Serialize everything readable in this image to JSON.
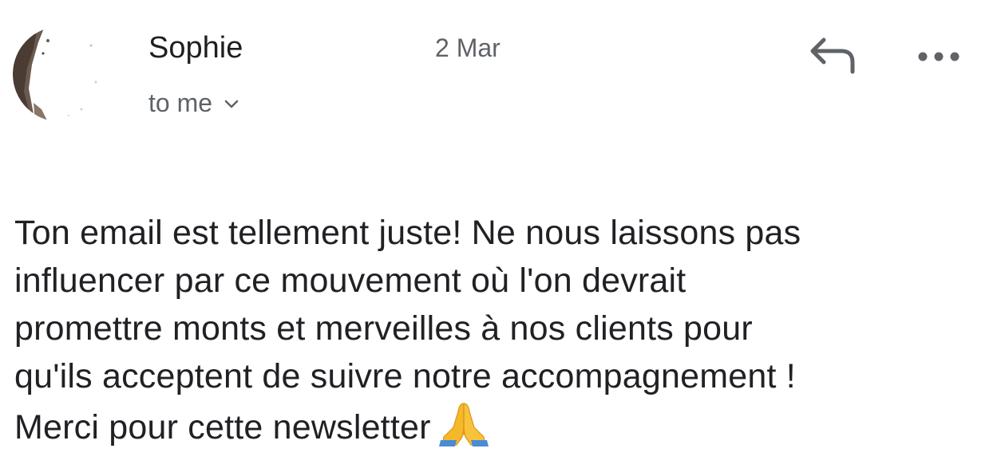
{
  "header": {
    "sender_name": "Sophie",
    "date": "2 Mar",
    "recipient_label": "to me"
  },
  "icons": {
    "avatar": "sender-avatar-photo",
    "reply": "reply-arrow-icon",
    "more": "more-options-icon",
    "chevron": "chevron-down-icon",
    "emoji": "folded-hands-emoji"
  },
  "message": {
    "lines": [
      "Ton email est tellement juste! Ne nous laissons pas",
      "influencer par ce mouvement où l'on devrait",
      "promettre monts et merveilles à nos clients pour",
      "qu'ils acceptent de suivre notre accompagnement !",
      "Merci pour cette newsletter"
    ]
  },
  "colors": {
    "text": "#202124",
    "secondary_text": "#5f6368",
    "icon": "#5f6368",
    "background": "#ffffff"
  }
}
